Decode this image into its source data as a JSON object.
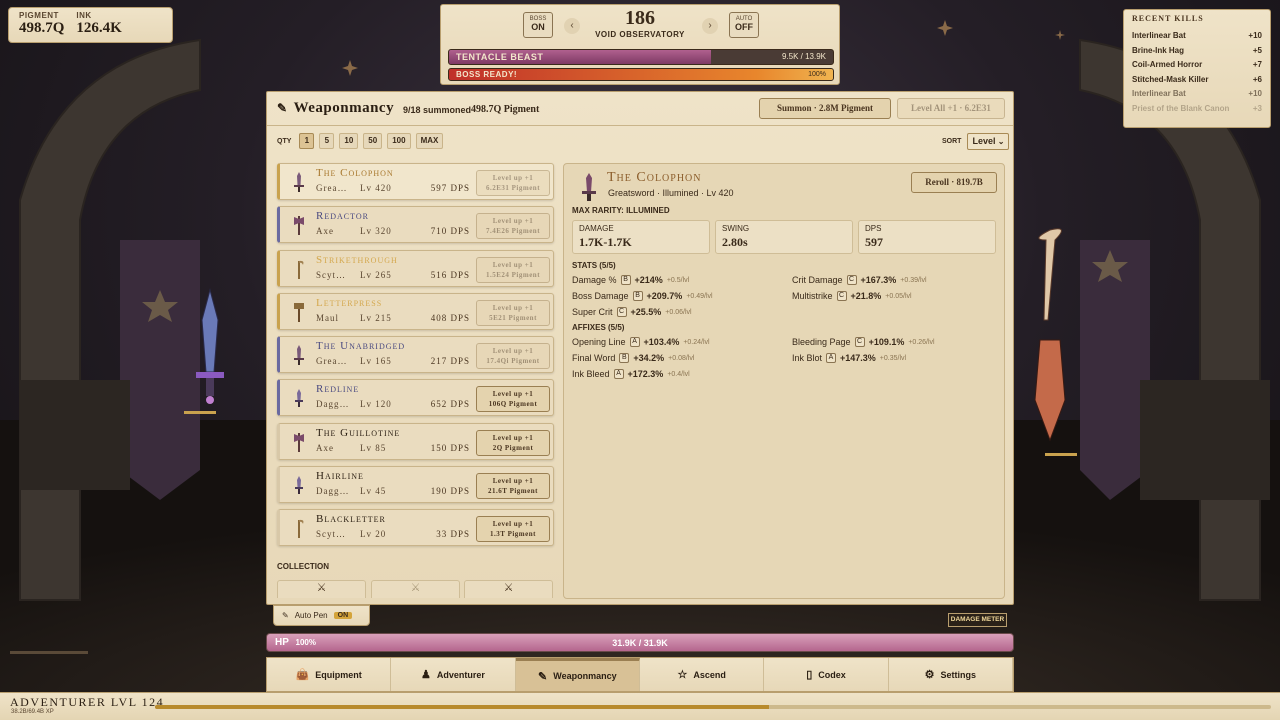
{
  "resources": {
    "pigment_label": "PIGMENT",
    "pigment_value": "498.7Q",
    "ink_label": "INK",
    "ink_value": "126.4K"
  },
  "boss": {
    "boss_toggle_label": "BOSS",
    "boss_toggle_value": "ON",
    "auto_toggle_label": "AUTO",
    "auto_toggle_value": "OFF",
    "prev_icon": "chevron-left-icon",
    "next_icon": "chevron-right-icon",
    "zone_number": "186",
    "zone_name": "VOID OBSERVATORY",
    "enemy_name": "TENTACLE BEAST",
    "enemy_hp": "9.5K / 13.9K",
    "enemy_hp_fraction": 0.683,
    "boss_ready_label": "BOSS READY!",
    "boss_ready_value": "100%",
    "boss_ready_fraction": 1.0
  },
  "recent_kills": {
    "title": "RECENT KILLS",
    "items": [
      {
        "name": "Interlinear Bat",
        "count": "+10"
      },
      {
        "name": "Brine-Ink Hag",
        "count": "+5"
      },
      {
        "name": "Coil-Armed Horror",
        "count": "+7"
      },
      {
        "name": "Stitched-Mask Killer",
        "count": "+6"
      },
      {
        "name": "Interlinear Bat",
        "count": "+10"
      },
      {
        "name": "Priest of the Blank Canon",
        "count": "+3"
      }
    ]
  },
  "panel": {
    "icon": "quill-icon",
    "title": "Weaponmancy",
    "summoned": "9/18 summoned",
    "pigment": "498.7Q Pigment",
    "summon_button": "Summon · 2.8M Pigment",
    "level_all_button": "Level All +1 · 6.2E31",
    "qty_label": "QTY",
    "qty_options": [
      "1",
      "5",
      "10",
      "50",
      "100",
      "MAX"
    ],
    "qty_selected": "1",
    "sort_label": "SORT",
    "sort_value": "Level",
    "sort_icon": "chevron-down-icon"
  },
  "colors": {
    "accent_gold": "#c9a24e",
    "enemy_hp": "#9c4a7e",
    "boss_ready": "#d9542a",
    "hp_pink": "#c47a9f",
    "rarity_illumined": "#c9a24e",
    "rarity_rare": "#6a6aa0",
    "rarity_common": "#d8c8a8"
  },
  "weapons": [
    {
      "name": "The Colophon",
      "type": "Grea…",
      "level": "Lv 420",
      "dps": "597 DPS",
      "levelup": "Level up +1",
      "cost": "6.2E31 Pigment",
      "affordable": false,
      "rarity": "illumined",
      "icon": "greatsword-icon"
    },
    {
      "name": "Redactor",
      "type": "Axe",
      "level": "Lv 320",
      "dps": "710 DPS",
      "levelup": "Level up +1",
      "cost": "7.4E26 Pigment",
      "affordable": false,
      "rarity": "rare",
      "icon": "axe-icon"
    },
    {
      "name": "Strikethrough",
      "type": "Scyt…",
      "level": "Lv 265",
      "dps": "516 DPS",
      "levelup": "Level up +1",
      "cost": "1.5E24 Pigment",
      "affordable": false,
      "rarity": "illumined",
      "icon": "scythe-icon"
    },
    {
      "name": "Letterpress",
      "type": "Maul",
      "level": "Lv 215",
      "dps": "408 DPS",
      "levelup": "Level up +1",
      "cost": "5E21 Pigment",
      "affordable": false,
      "rarity": "illumined",
      "icon": "maul-icon"
    },
    {
      "name": "The Unabridged",
      "type": "Grea…",
      "level": "Lv 165",
      "dps": "217 DPS",
      "levelup": "Level up +1",
      "cost": "17.4Qi Pigment",
      "affordable": false,
      "rarity": "rare",
      "icon": "greatsword-icon"
    },
    {
      "name": "Redline",
      "type": "Dagg…",
      "level": "Lv 120",
      "dps": "652 DPS",
      "levelup": "Level up +1",
      "cost": "106Q Pigment",
      "affordable": true,
      "rarity": "rare",
      "icon": "dagger-icon"
    },
    {
      "name": "The Guillotine",
      "type": "Axe",
      "level": "Lv 85",
      "dps": "150 DPS",
      "levelup": "Level up +1",
      "cost": "2Q Pigment",
      "affordable": true,
      "rarity": "common",
      "icon": "axe-icon"
    },
    {
      "name": "Hairline",
      "type": "Dagg…",
      "level": "Lv 45",
      "dps": "190 DPS",
      "levelup": "Level up +1",
      "cost": "21.6T Pigment",
      "affordable": true,
      "rarity": "common",
      "icon": "dagger-icon"
    },
    {
      "name": "Blackletter",
      "type": "Scyt…",
      "level": "Lv 20",
      "dps": "33 DPS",
      "levelup": "Level up +1",
      "cost": "1.3T Pigment",
      "affordable": true,
      "rarity": "common",
      "icon": "scythe-icon"
    }
  ],
  "collection": {
    "label": "COLLECTION",
    "slots": [
      "sword-icon",
      "sword-icon",
      "sword-icon"
    ]
  },
  "detail": {
    "icon": "greatsword-icon",
    "name": "The Colophon",
    "subtitle": "Greatsword · Illumined · Lv 420",
    "reroll": "Reroll · 819.7B",
    "max_rarity": "MAX RARITY: ILLUMINED",
    "boxes": [
      {
        "label": "DAMAGE",
        "value": "1.7K-1.7K"
      },
      {
        "label": "SWING",
        "value": "2.80s"
      },
      {
        "label": "DPS",
        "value": "597"
      }
    ],
    "stats_title": "STATS (5/5)",
    "stats": [
      {
        "name": "Damage %",
        "tier": "B",
        "value": "+214%",
        "per": "+0.5/lvl"
      },
      {
        "name": "Crit Damage",
        "tier": "C",
        "value": "+167.3%",
        "per": "+0.39/lvl"
      },
      {
        "name": "Boss Damage",
        "tier": "B",
        "value": "+209.7%",
        "per": "+0.49/lvl"
      },
      {
        "name": "Multistrike",
        "tier": "C",
        "value": "+21.8%",
        "per": "+0.05/lvl"
      },
      {
        "name": "Super Crit",
        "tier": "C",
        "value": "+25.5%",
        "per": "+0.06/lvl"
      }
    ],
    "affixes_title": "AFFIXES (5/5)",
    "affixes": [
      {
        "name": "Opening Line",
        "tier": "A",
        "value": "+103.4%",
        "per": "+0.24/lvl"
      },
      {
        "name": "Bleeding Page",
        "tier": "C",
        "value": "+109.1%",
        "per": "+0.26/lvl"
      },
      {
        "name": "Final Word",
        "tier": "B",
        "value": "+34.2%",
        "per": "+0.08/lvl"
      },
      {
        "name": "Ink Blot",
        "tier": "A",
        "value": "+147.3%",
        "per": "+0.35/lvl"
      },
      {
        "name": "Ink Bleed",
        "tier": "A",
        "value": "+172.3%",
        "per": "+0.4/lvl"
      }
    ]
  },
  "autopen": {
    "label": "Auto Pen",
    "value": "ON",
    "icon": "quill-icon"
  },
  "damage_meter": "DAMAGE METER",
  "player_hp": {
    "label": "HP",
    "percent": "100%",
    "value": "31.9K / 31.9K",
    "fraction": 1.0
  },
  "nav": [
    {
      "label": "Equipment",
      "icon": "bag-icon",
      "active": false
    },
    {
      "label": "Adventurer",
      "icon": "hooded-figure-icon",
      "active": false
    },
    {
      "label": "Weaponmancy",
      "icon": "quill-icon",
      "active": true
    },
    {
      "label": "Ascend",
      "icon": "star-icon",
      "active": false
    },
    {
      "label": "Codex",
      "icon": "book-icon",
      "active": false
    },
    {
      "label": "Settings",
      "icon": "gear-icon",
      "active": false
    }
  ],
  "adventurer": {
    "label": "ADVENTURER LVL 124",
    "xp": "38.2B/69.4B XP",
    "xp_fraction": 0.55
  }
}
